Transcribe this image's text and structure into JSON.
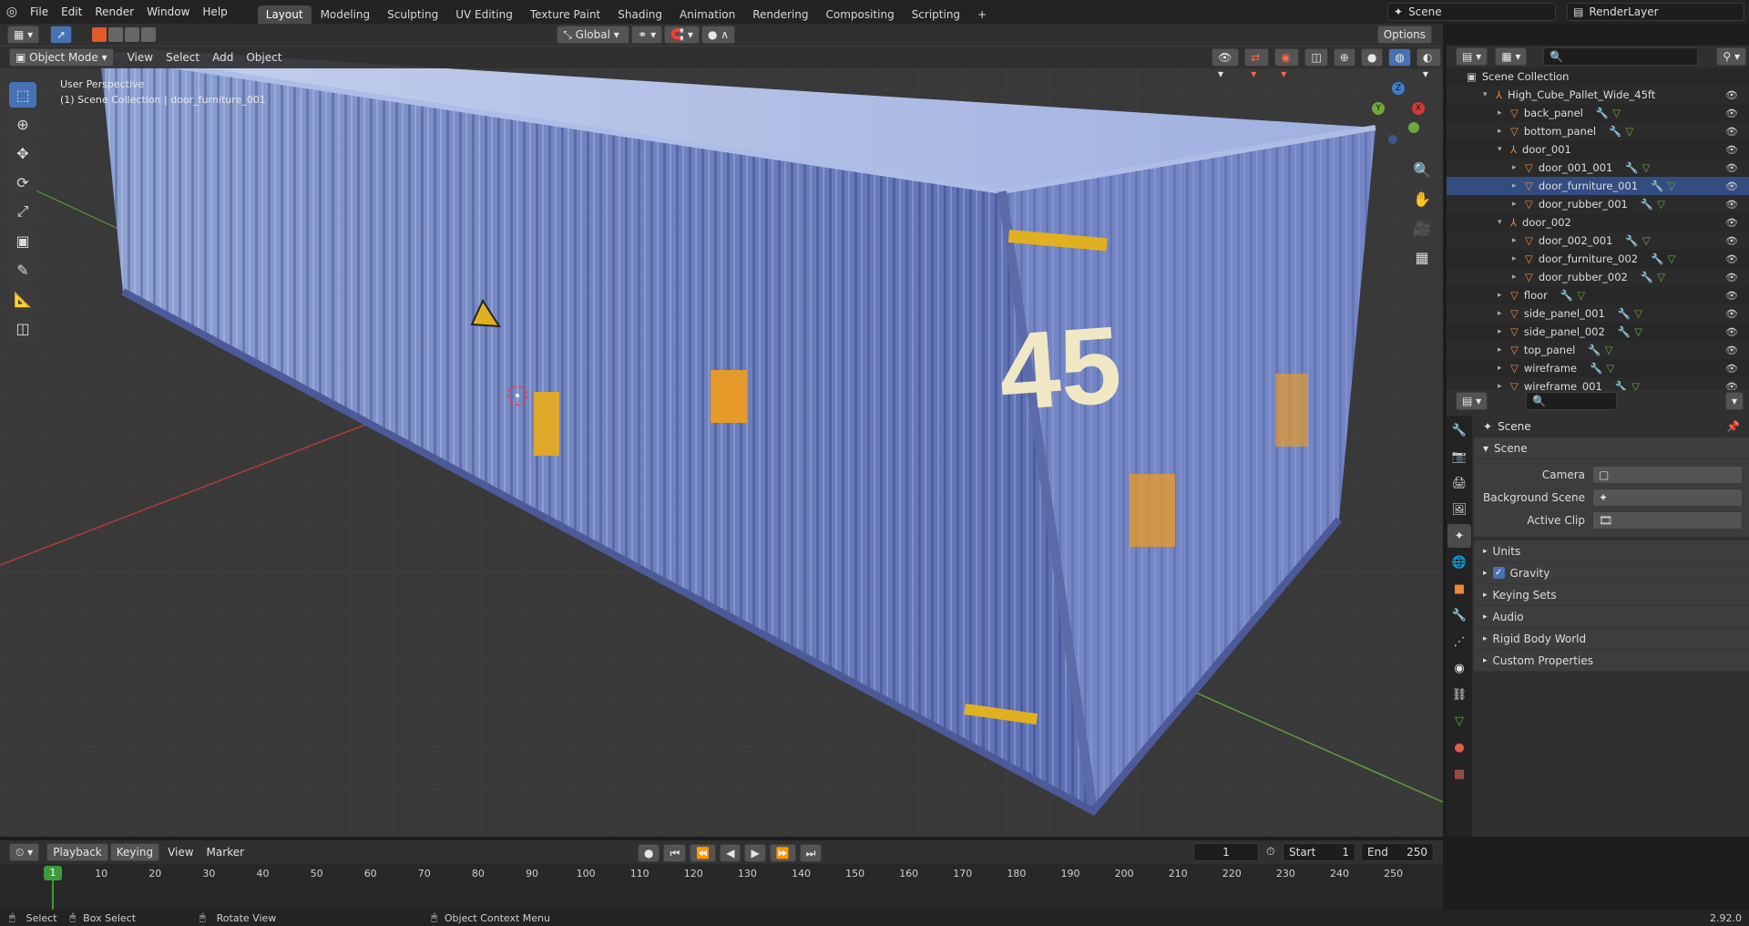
{
  "topbar": {
    "menus": [
      "File",
      "Edit",
      "Render",
      "Window",
      "Help"
    ],
    "workspaces": [
      "Layout",
      "Modeling",
      "Sculpting",
      "UV Editing",
      "Texture Paint",
      "Shading",
      "Animation",
      "Rendering",
      "Compositing",
      "Scripting"
    ],
    "active_workspace": "Layout",
    "add_tab": "+",
    "scene": "Scene",
    "view_layer": "RenderLayer"
  },
  "viewport_header": {
    "mode": "Object Mode",
    "menus": [
      "View",
      "Select",
      "Add",
      "Object"
    ],
    "transform_orientation": "Global",
    "options": "Options"
  },
  "viewport": {
    "perspective": "User Perspective",
    "collection_info": "(1) Scene Collection | door_furniture_001",
    "gizmo_axes": [
      "X",
      "Y",
      "Z"
    ],
    "container_number": "45"
  },
  "outliner": {
    "root": "Scene Collection",
    "rows": [
      {
        "label": "High_Cube_Pallet_Wide_45ft",
        "depth": 0,
        "kind": "empty",
        "expanded": true
      },
      {
        "label": "back_panel",
        "depth": 1,
        "kind": "mesh"
      },
      {
        "label": "bottom_panel",
        "depth": 1,
        "kind": "mesh"
      },
      {
        "label": "door_001",
        "depth": 1,
        "kind": "empty",
        "expanded": true
      },
      {
        "label": "door_001_001",
        "depth": 2,
        "kind": "mesh"
      },
      {
        "label": "door_furniture_001",
        "depth": 2,
        "kind": "mesh",
        "selected": true
      },
      {
        "label": "door_rubber_001",
        "depth": 2,
        "kind": "mesh"
      },
      {
        "label": "door_002",
        "depth": 1,
        "kind": "empty",
        "expanded": true
      },
      {
        "label": "door_002_001",
        "depth": 2,
        "kind": "mesh"
      },
      {
        "label": "door_furniture_002",
        "depth": 2,
        "kind": "mesh"
      },
      {
        "label": "door_rubber_002",
        "depth": 2,
        "kind": "mesh"
      },
      {
        "label": "floor",
        "depth": 1,
        "kind": "mesh"
      },
      {
        "label": "side_panel_001",
        "depth": 1,
        "kind": "mesh"
      },
      {
        "label": "side_panel_002",
        "depth": 1,
        "kind": "mesh"
      },
      {
        "label": "top_panel",
        "depth": 1,
        "kind": "mesh"
      },
      {
        "label": "wireframe",
        "depth": 1,
        "kind": "mesh"
      },
      {
        "label": "wireframe_001",
        "depth": 1,
        "kind": "mesh"
      }
    ]
  },
  "properties": {
    "context": "Scene",
    "panel": "Scene",
    "fields": [
      {
        "label": "Camera",
        "value": ""
      },
      {
        "label": "Background Scene",
        "value": ""
      },
      {
        "label": "Active Clip",
        "value": ""
      }
    ],
    "subpanels": [
      "Units",
      "Gravity",
      "Keying Sets",
      "Audio",
      "Rigid Body World",
      "Custom Properties"
    ],
    "gravity_checked": true
  },
  "timeline": {
    "menus": [
      "Playback",
      "Keying",
      "View",
      "Marker"
    ],
    "current_frame": "1",
    "start_label": "Start",
    "start": "1",
    "end_label": "End",
    "end": "250",
    "ruler": [
      "10",
      "20",
      "30",
      "40",
      "50",
      "60",
      "70",
      "80",
      "90",
      "100",
      "110",
      "120",
      "130",
      "140",
      "150",
      "160",
      "170",
      "180",
      "190",
      "200",
      "210",
      "220",
      "230",
      "240",
      "250"
    ],
    "playhead": "1"
  },
  "statusbar": {
    "select": "Select",
    "box_select": "Box Select",
    "rotate": "Rotate View",
    "context_menu": "Object Context Menu",
    "version": "2.92.0"
  },
  "colors": {
    "accent": "#4772b3",
    "selected": "#334d80",
    "x_axis": "#cc3b3b",
    "y_axis": "#6ea83d",
    "z_axis": "#3d7ecc"
  }
}
